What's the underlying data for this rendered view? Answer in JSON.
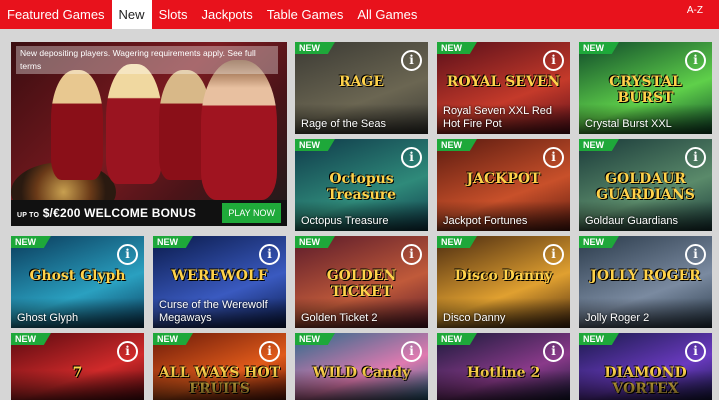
{
  "nav": {
    "tabs": [
      {
        "label": "Featured Games"
      },
      {
        "label": "New"
      },
      {
        "label": "Slots"
      },
      {
        "label": "Jackpots"
      },
      {
        "label": "Table Games"
      },
      {
        "label": "All Games"
      }
    ],
    "active_tab": "New",
    "sort_label": "A-Z"
  },
  "promo": {
    "notice": "New depositing players. Wagering requirements apply. See full terms",
    "bonus_prefix": "UP TO",
    "bonus_text": "$/€200 WELCOME BONUS",
    "cta_label": "PLAY NOW"
  },
  "badge_label": "NEW",
  "info_icon": "i",
  "colors": {
    "brand": "#e8121c",
    "badge": "#1ea83a",
    "cta": "#1faa3a"
  },
  "games": [
    {
      "name": "Rage of the Seas",
      "logo": "RAGE",
      "theme": [
        "#3b3a34",
        "#6b6652"
      ]
    },
    {
      "name": "Royal Seven XXL Red Hot Fire Pot",
      "logo": "ROYAL SEVEN",
      "theme": [
        "#5a0f1a",
        "#c43a2a"
      ]
    },
    {
      "name": "Crystal Burst XXL",
      "logo": "CRYSTAL BURST",
      "theme": [
        "#0f4a2a",
        "#5fd04a"
      ]
    },
    {
      "name": "Octopus Treasure",
      "logo": "Octopus Treasure",
      "theme": [
        "#0f3a4a",
        "#2f8a7a"
      ]
    },
    {
      "name": "Jackpot Fortunes",
      "logo": "JACKPOT",
      "theme": [
        "#5a1a10",
        "#c8502a"
      ]
    },
    {
      "name": "Goldaur Guardians",
      "logo": "GOLDAUR GUARDIANS",
      "theme": [
        "#1a3a3a",
        "#5a8a6a"
      ]
    },
    {
      "name": "Ghost Glyph",
      "logo": "Ghost Glyph",
      "theme": [
        "#0a3a5a",
        "#2aa0c0"
      ]
    },
    {
      "name": "Curse of the Werewolf Megaways",
      "logo": "WEREWOLF",
      "theme": [
        "#0a1a4a",
        "#3a5ac0"
      ]
    },
    {
      "name": "Golden Ticket 2",
      "logo": "GOLDEN TICKET",
      "theme": [
        "#5a1a2a",
        "#c05a3a"
      ]
    },
    {
      "name": "Disco Danny",
      "logo": "Disco Danny",
      "theme": [
        "#4a2a10",
        "#e0a030"
      ]
    },
    {
      "name": "Jolly Roger 2",
      "logo": "JOLLY ROGER",
      "theme": [
        "#2a3a4a",
        "#7a8aa0"
      ]
    },
    {
      "name": "",
      "logo": "7",
      "theme": [
        "#5a0a10",
        "#d02a2a"
      ]
    },
    {
      "name": "",
      "logo": "ALL WAYS HOT FRUITS",
      "theme": [
        "#6a1a0a",
        "#e05a1a"
      ]
    },
    {
      "name": "",
      "logo": "WILD Candy",
      "theme": [
        "#2a6a8a",
        "#e07ab0"
      ]
    },
    {
      "name": "",
      "logo": "Hotline 2",
      "theme": [
        "#1a1a3a",
        "#8a3a8a"
      ]
    },
    {
      "name": "",
      "logo": "DIAMOND VORTEX",
      "theme": [
        "#1a1a4a",
        "#6a3ac0"
      ]
    }
  ]
}
